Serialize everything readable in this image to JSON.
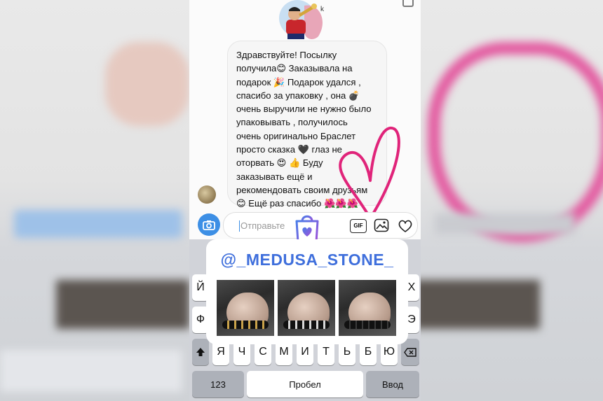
{
  "message": {
    "text": "Здравствуйте! Посылку\nполучила😊 Заказывала на\nподарок 🎉 Подарок удался ,\nспасибо за  упаковку  , она 💣\nочень выручили не нужно было\nупаковывать , получилось\nочень оригинально Браслет\nпросто сказка 🖤 глаз не\nоторвать 😍 👍 Буду\nзаказывать ещё и\nрекомендовать своим друзьям\n😊 Ещё раз спасибо 🌺🌺🌺"
  },
  "sticker": {
    "letter": "k"
  },
  "composer": {
    "placeholder": "Отправьте",
    "gif_label": "GIF",
    "icons": [
      "camera-icon",
      "gif-icon",
      "photo-icon",
      "heart-icon"
    ]
  },
  "mention": {
    "handle": "@_MEDUSA_STONE_"
  },
  "keyboard": {
    "row1_visible": [
      "Й",
      "Х"
    ],
    "row2_visible": [
      "Ф",
      "Э"
    ],
    "row3": [
      "Я",
      "Ч",
      "С",
      "М",
      "И",
      "Т",
      "Ь",
      "Б",
      "Ю"
    ],
    "numbers_label": "123",
    "space_label": "Пробел",
    "return_label": "Ввод"
  },
  "colors": {
    "accent": "#3d8fe5",
    "mention_text": "#3f6fdc",
    "doodle": "#e0247a",
    "shop_gradient": [
      "#4a7de8",
      "#a24fd8"
    ]
  }
}
